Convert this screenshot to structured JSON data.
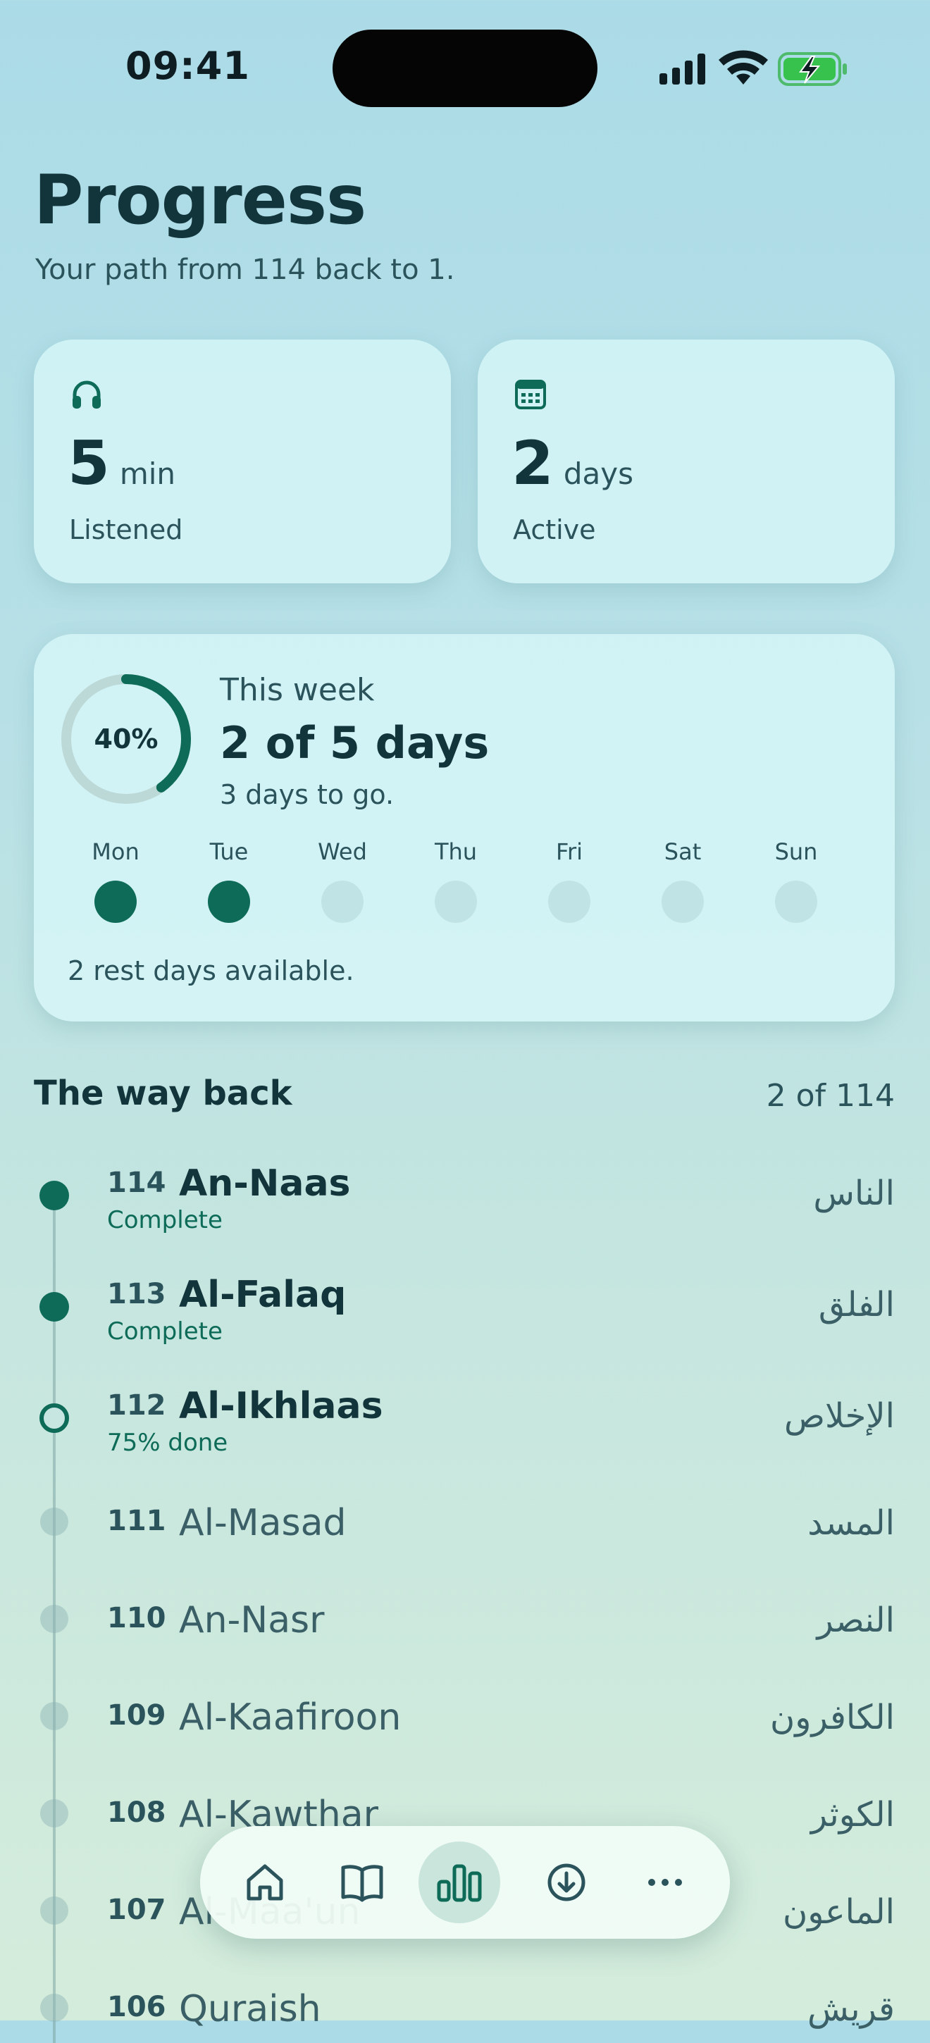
{
  "status": {
    "time": "09:41"
  },
  "header": {
    "title": "Progress",
    "subtitle": "Your path from 114 back to 1."
  },
  "stats": [
    {
      "icon": "headphones-icon",
      "value": "5",
      "unit": "min",
      "label": "Listened"
    },
    {
      "icon": "calendar-icon",
      "value": "2",
      "unit": "days",
      "label": "Active"
    }
  ],
  "week": {
    "percent": 0.4,
    "percent_label": "40%",
    "label": "This week",
    "value": "2 of 5 days",
    "sub": "3 days to go.",
    "days": [
      {
        "name": "Mon",
        "done": true
      },
      {
        "name": "Tue",
        "done": true
      },
      {
        "name": "Wed",
        "done": false
      },
      {
        "name": "Thu",
        "done": false
      },
      {
        "name": "Fri",
        "done": false
      },
      {
        "name": "Sat",
        "done": false
      },
      {
        "name": "Sun",
        "done": false
      }
    ],
    "rest": "2 rest days available."
  },
  "way": {
    "title": "The way back",
    "count": "2 of 114",
    "surahs": [
      {
        "num": "114",
        "name": "An-Naas",
        "arabic": "الناس",
        "status": "Complete"
      },
      {
        "num": "113",
        "name": "Al-Falaq",
        "arabic": "الفلق",
        "status": "Complete"
      },
      {
        "num": "112",
        "name": "Al-Ikhlaas",
        "arabic": "الإخلاص",
        "status": "75% done"
      },
      {
        "num": "111",
        "name": "Al-Masad",
        "arabic": "المسد"
      },
      {
        "num": "110",
        "name": "An-Nasr",
        "arabic": "النصر"
      },
      {
        "num": "109",
        "name": "Al-Kaafiroon",
        "arabic": "الكافرون"
      },
      {
        "num": "108",
        "name": "Al-Kawthar",
        "arabic": "الكوثر"
      },
      {
        "num": "107",
        "name": "Al-Maa'un",
        "arabic": "الماعون"
      },
      {
        "num": "106",
        "name": "Quraish",
        "arabic": "قريش"
      }
    ]
  },
  "tabs": [
    {
      "icon": "home-icon",
      "active": false
    },
    {
      "icon": "book-icon",
      "active": false
    },
    {
      "icon": "bar-chart-icon",
      "active": true
    },
    {
      "icon": "download-icon",
      "active": false
    },
    {
      "icon": "more-icon",
      "active": false
    }
  ],
  "colors": {
    "accent": "#0d6b58",
    "text": "#12343b",
    "muted": "#2b535b"
  }
}
